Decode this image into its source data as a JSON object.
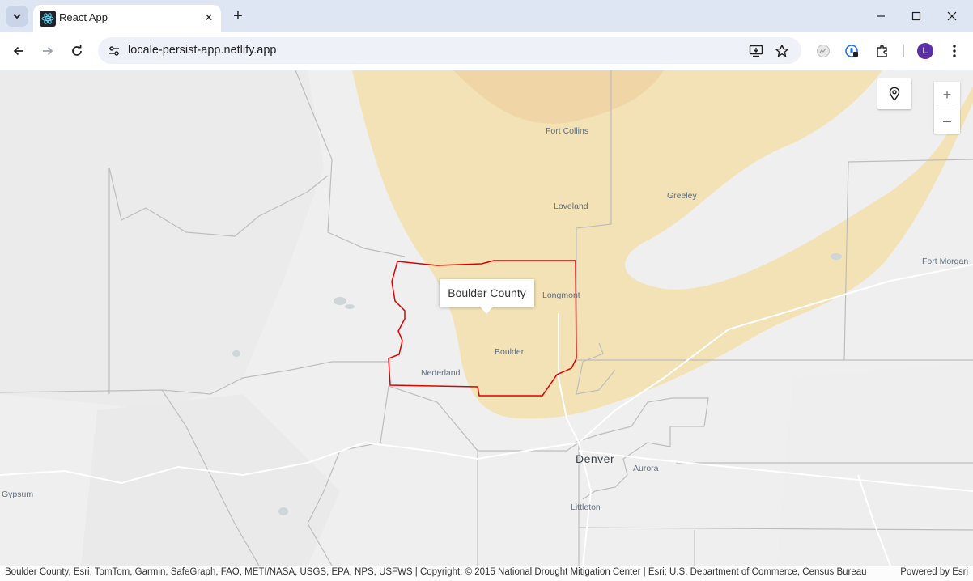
{
  "browser": {
    "tab": {
      "title": "React App",
      "favicon": "react-icon",
      "close_glyph": "✕"
    },
    "new_tab_glyph": "+",
    "url": "locale-persist-app.netlify.app",
    "profile_initial": "L",
    "window_controls": [
      "minimize",
      "maximize",
      "close"
    ]
  },
  "map": {
    "places": {
      "fort_collins": "Fort Collins",
      "loveland": "Loveland",
      "greeley": "Greeley",
      "fort_morgan": "Fort Morgan",
      "longmont": "Longmont",
      "boulder": "Boulder",
      "nederland": "Nederland",
      "denver": "Denver",
      "aurora": "Aurora",
      "littleton": "Littleton",
      "gypsum": "Gypsum"
    },
    "popup": {
      "title": "Boulder County"
    },
    "highlight_color": "#e00000",
    "drought_colors": {
      "light": "#f2e2b6",
      "medium": "#f0d6a6"
    },
    "controls": {
      "zoom_in": "+",
      "zoom_out": "–",
      "locate": "pin-icon"
    },
    "attribution": "Boulder County, Esri, TomTom, Garmin, SafeGraph, FAO, METI/NASA, USGS, EPA, NPS, USFWS | Copyright: © 2015 National Drought Mitigation Center | Esri; U.S. Department of Commerce, Census Bureau",
    "powered_by": "Powered by Esri"
  }
}
